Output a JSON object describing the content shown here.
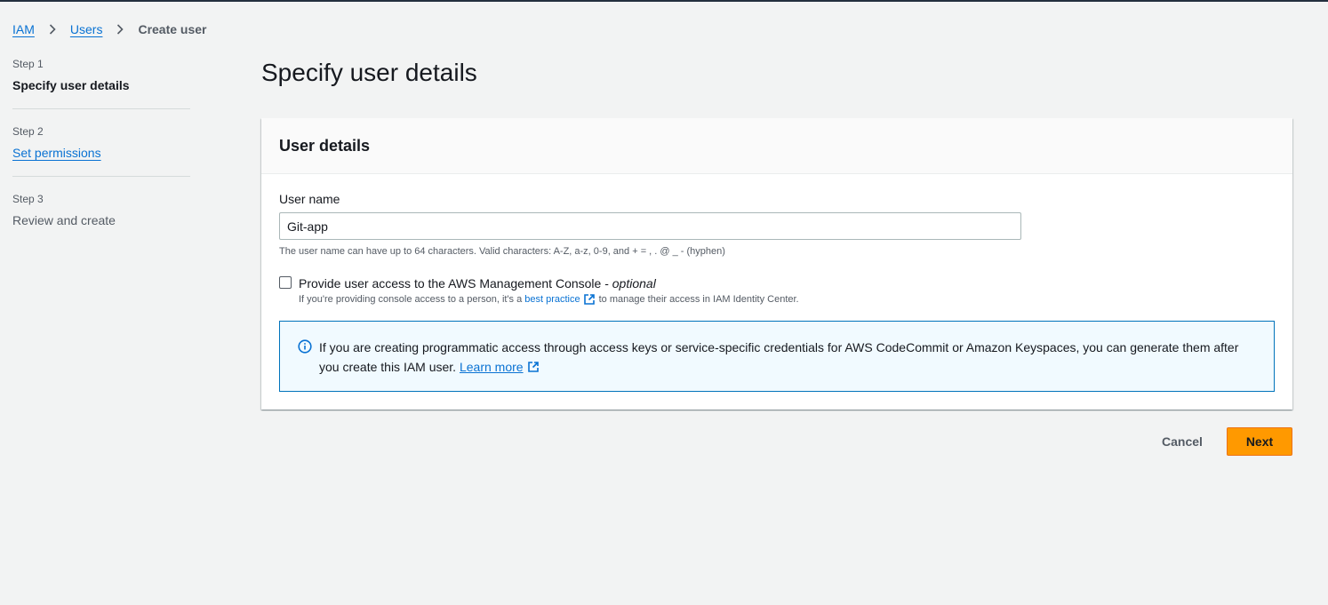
{
  "breadcrumb": {
    "items": [
      {
        "label": "IAM"
      },
      {
        "label": "Users"
      },
      {
        "label": "Create user"
      }
    ]
  },
  "steps": [
    {
      "number": "Step 1",
      "label": "Specify user details",
      "state": "active"
    },
    {
      "number": "Step 2",
      "label": "Set permissions",
      "state": "link"
    },
    {
      "number": "Step 3",
      "label": "Review and create",
      "state": "disabled"
    }
  ],
  "page": {
    "title": "Specify user details"
  },
  "panel": {
    "header": "User details",
    "user_name_label": "User name",
    "user_name_value": "Git-app",
    "user_name_constraint": "The user name can have up to 64 characters. Valid characters: A-Z, a-z, 0-9, and + = , . @ _ - (hyphen)",
    "console_access_label": "Provide user access to the AWS Management Console - ",
    "console_access_optional": "optional",
    "console_access_checked": false,
    "console_desc_pre": "If you're providing console access to a person, it's a",
    "console_desc_link": "best practice",
    "console_desc_post": "to manage their access in IAM Identity Center.",
    "alert_text": "If you are creating programmatic access through access keys or service-specific credentials for AWS CodeCommit or Amazon Keyspaces, you can generate them after you create this IAM user.",
    "alert_link": "Learn more"
  },
  "actions": {
    "cancel_label": "Cancel",
    "next_label": "Next"
  },
  "icons": {
    "separator": "chevron-right-icon",
    "external": "external-link-icon",
    "info": "info-icon"
  },
  "colors": {
    "primary_button": "#ff9900",
    "link": "#0972d3",
    "alert_border": "#0073bb",
    "alert_bg": "#f1faff"
  }
}
